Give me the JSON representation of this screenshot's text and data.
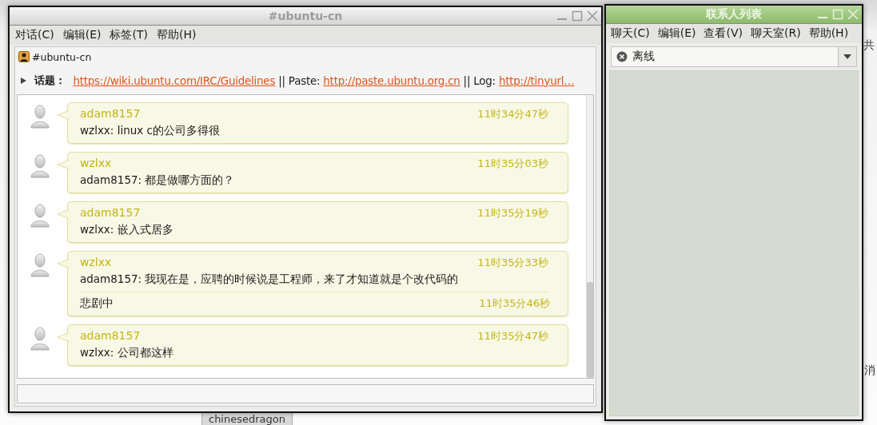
{
  "background_window": {
    "tab": "chinesedragon",
    "fragments": [
      "共",
      "消"
    ]
  },
  "chat_window": {
    "title": "#ubuntu-cn",
    "menu": [
      "对话(C)",
      "编辑(E)",
      "标签(T)",
      "帮助(H)"
    ],
    "channel": "#ubuntu-cn",
    "topic_label": "话题：",
    "topic": [
      {
        "kind": "link",
        "text": "https://wiki.ubuntu.com/IRC/Guidelines"
      },
      {
        "kind": "plain",
        "text": "|| Paste:"
      },
      {
        "kind": "link",
        "text": "http://paste.ubuntu.org.cn"
      },
      {
        "kind": "plain",
        "text": "|| Log:"
      },
      {
        "kind": "link",
        "text": "http://tinyurl…"
      }
    ],
    "messages": [
      {
        "nick": "adam8157",
        "lines": [
          {
            "text": "wzlxx: linux c的公司多得很",
            "time": "11时34分47秒"
          }
        ]
      },
      {
        "nick": "wzlxx",
        "lines": [
          {
            "text": "adam8157: 都是做哪方面的？",
            "time": "11时35分03秒"
          }
        ]
      },
      {
        "nick": "adam8157",
        "lines": [
          {
            "text": "wzlxx: 嵌入式居多",
            "time": "11时35分19秒"
          }
        ]
      },
      {
        "nick": "wzlxx",
        "lines": [
          {
            "text": "adam8157: 我现在是，应聘的时候说是工程师，来了才知道就是个改代码的",
            "time": "11时35分33秒"
          },
          {
            "text": "悲剧中",
            "time": "11时35分46秒"
          }
        ]
      },
      {
        "nick": "adam8157",
        "lines": [
          {
            "text": "wzlxx: 公司都这样",
            "time": "11时35分47秒"
          }
        ]
      }
    ]
  },
  "buddy_window": {
    "title": "联系人列表",
    "menu": [
      "聊天(C)",
      "编辑(E)",
      "查看(V)",
      "聊天室(R)",
      "帮助(H)"
    ],
    "status": "离线"
  }
}
